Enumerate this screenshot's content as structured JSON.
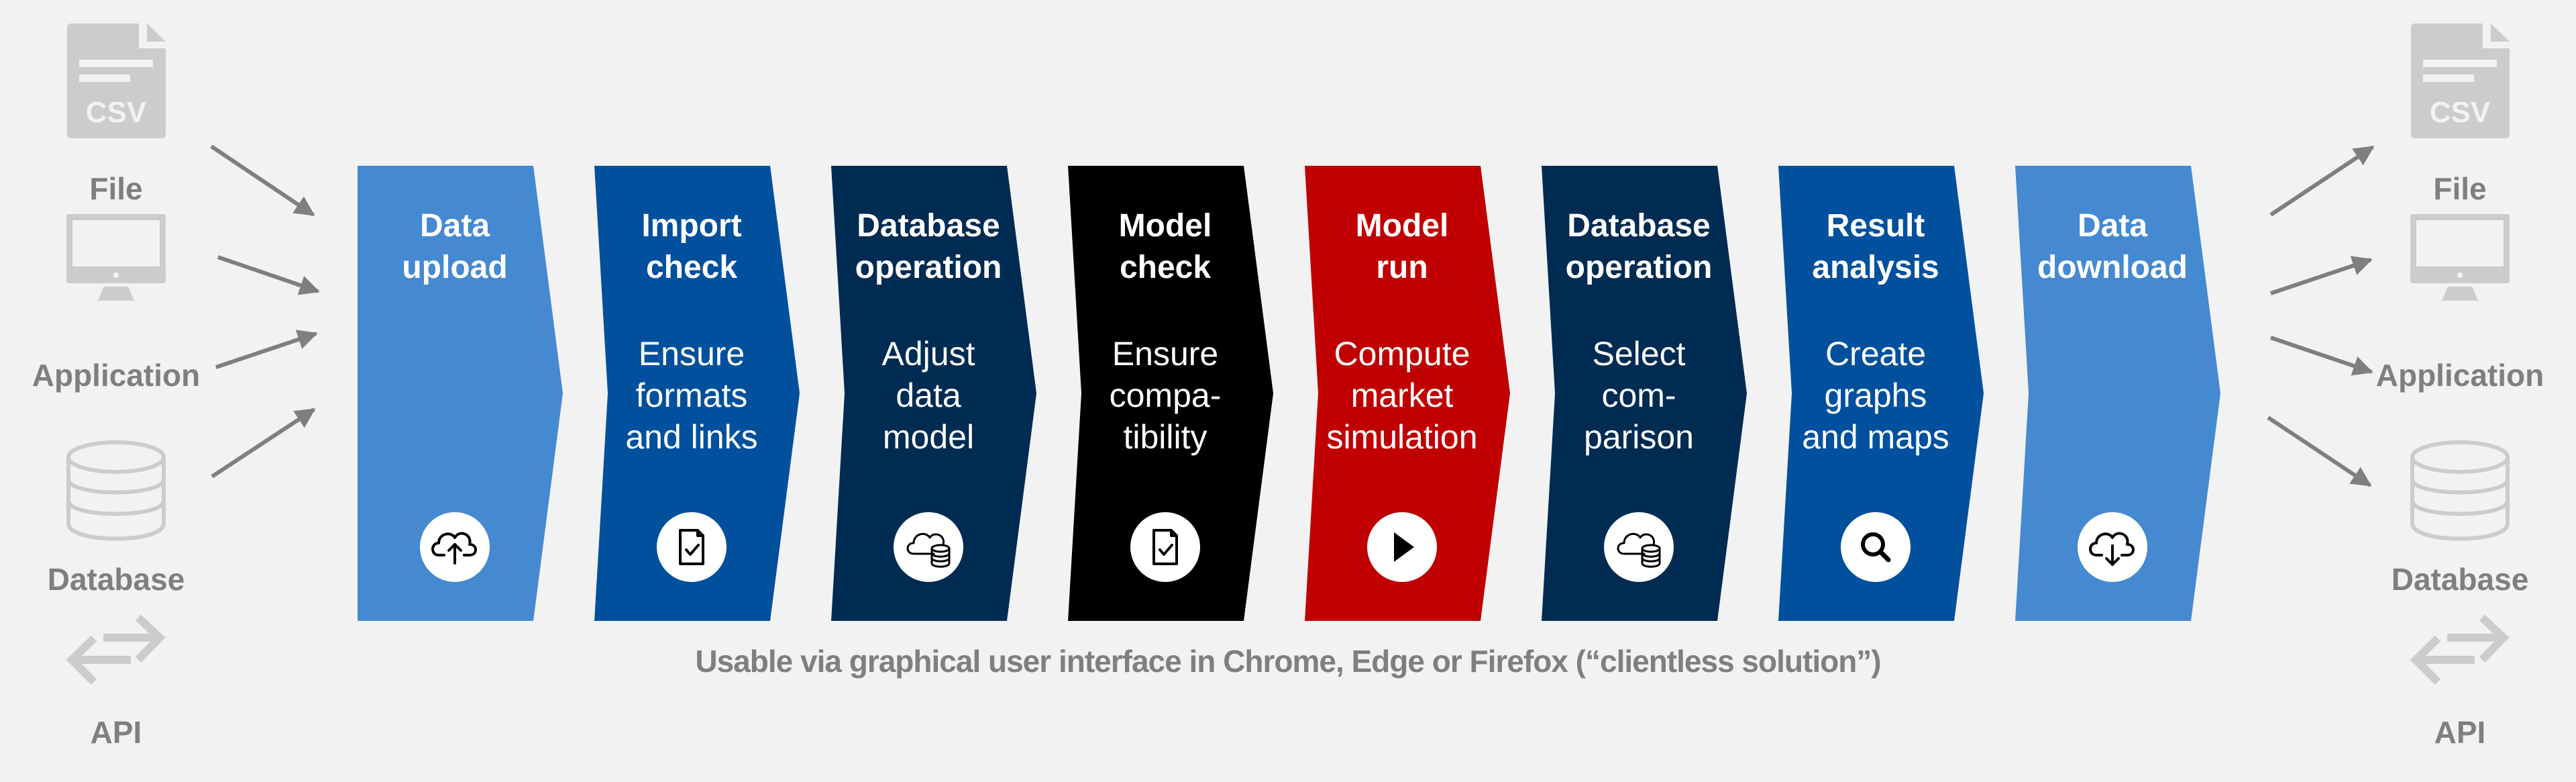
{
  "colors": {
    "background": "#f2f2f2",
    "side_icon": "#cccccc",
    "side_text": "#7f7f7f",
    "arrow": "#7f7f7f",
    "icon_circle": "#ffffff",
    "icon_stroke": "#000000"
  },
  "inputs": {
    "items": [
      {
        "label": "File",
        "icon": "csv-file-icon",
        "icon_text": "CSV"
      },
      {
        "label": "Application",
        "icon": "monitor-icon"
      },
      {
        "label": "Database",
        "icon": "database-icon"
      },
      {
        "label": "API",
        "icon": "exchange-arrows-icon"
      }
    ]
  },
  "outputs": {
    "items": [
      {
        "label": "File",
        "icon": "csv-file-icon",
        "icon_text": "CSV"
      },
      {
        "label": "Application",
        "icon": "monitor-icon"
      },
      {
        "label": "Database",
        "icon": "database-icon"
      },
      {
        "label": "API",
        "icon": "exchange-arrows-icon"
      }
    ]
  },
  "steps": [
    {
      "title": [
        "Data",
        "upload"
      ],
      "desc": [],
      "color": "#4589d1",
      "icon": "cloud-upload-icon"
    },
    {
      "title": [
        "Import",
        "check"
      ],
      "desc": [
        "Ensure",
        "formats",
        "and links"
      ],
      "color": "#00509d",
      "icon": "document-check-icon"
    },
    {
      "title": [
        "Database",
        "operation"
      ],
      "desc": [
        "Adjust",
        "data",
        "model"
      ],
      "color": "#002b52",
      "icon": "cloud-database-icon"
    },
    {
      "title": [
        "Model",
        "check"
      ],
      "desc": [
        "Ensure",
        "compa-",
        "tibility"
      ],
      "color": "#000000",
      "icon": "document-check-icon"
    },
    {
      "title": [
        "Model",
        "run"
      ],
      "desc": [
        "Compute",
        "market",
        "simulation"
      ],
      "color": "#c00000",
      "icon": "play-icon"
    },
    {
      "title": [
        "Database",
        "operation"
      ],
      "desc": [
        "Select",
        "com-",
        "parison"
      ],
      "color": "#002b52",
      "icon": "cloud-database-icon"
    },
    {
      "title": [
        "Result",
        "analysis"
      ],
      "desc": [
        "Create",
        "graphs",
        "and maps"
      ],
      "color": "#00509d",
      "icon": "search-icon"
    },
    {
      "title": [
        "Data",
        "download"
      ],
      "desc": [],
      "color": "#4589d1",
      "icon": "cloud-download-icon"
    }
  ],
  "caption": "Usable via graphical user interface in Chrome, Edge or Firefox (“clientless solution”)"
}
